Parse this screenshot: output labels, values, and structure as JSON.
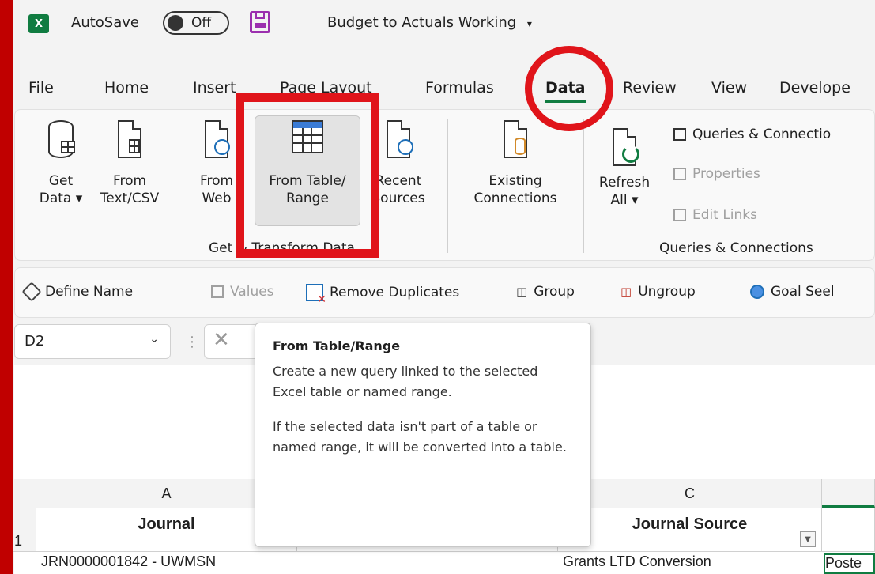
{
  "titlebar": {
    "app_logo": "X",
    "autosave_label": "AutoSave",
    "autosave_state": "Off",
    "document_title": "Budget to Actuals Working",
    "title_caret": "▾"
  },
  "menu": {
    "tabs": [
      {
        "label": "File"
      },
      {
        "label": "Home"
      },
      {
        "label": "Insert"
      },
      {
        "label": "Page Layout"
      },
      {
        "label": "Formulas"
      },
      {
        "label": "Data",
        "active": true
      },
      {
        "label": "Review"
      },
      {
        "label": "View"
      },
      {
        "label": "Develope"
      }
    ]
  },
  "ribbon": {
    "get_data": {
      "line1": "Get",
      "line2": "Data ▾"
    },
    "from_text": {
      "line1": "From",
      "line2": "Text/CSV"
    },
    "from_web": {
      "line1": "From",
      "line2": "Web"
    },
    "from_table": {
      "line1": "From Table/",
      "line2": "Range"
    },
    "recent_sources": {
      "line1": "Recent",
      "line2": "Sources"
    },
    "existing_connections": {
      "line1": "Existing",
      "line2": "Connections"
    },
    "group_get_transform": "Get & Transform Data",
    "refresh_all": {
      "line1": "Refresh",
      "line2": "All ▾"
    },
    "queries_connections": "Queries & Connectio",
    "properties": "Properties",
    "edit_links": "Edit Links",
    "group_queries": "Queries & Connections"
  },
  "quickbar": {
    "define_name": "Define Name",
    "values": "Values",
    "remove_duplicates": "Remove Duplicates",
    "group": "Group",
    "ungroup": "Ungroup",
    "goal_seek": "Goal Seel"
  },
  "formula_bar": {
    "name_box": "D2",
    "dropdown": "⌄",
    "separator": "⋮",
    "cancel": "✕"
  },
  "tooltip": {
    "title": "From Table/Range",
    "para1": "Create a new query linked to the selected Excel table or named range.",
    "para2": "If the selected data isn't part of a table or named range, it will be converted into a table."
  },
  "sheet": {
    "col_a": "A",
    "col_c": "C",
    "row1": "1",
    "header_a": "Journal",
    "header_c": "Journal Source",
    "row2_a": "JRN0000001842 - UWMSN",
    "row2_c": "Grants LTD Conversion",
    "row2_d": "Poste"
  },
  "colors": {
    "annotation": "#e0141a",
    "excel_green": "#107c41",
    "border": "#c00000"
  }
}
